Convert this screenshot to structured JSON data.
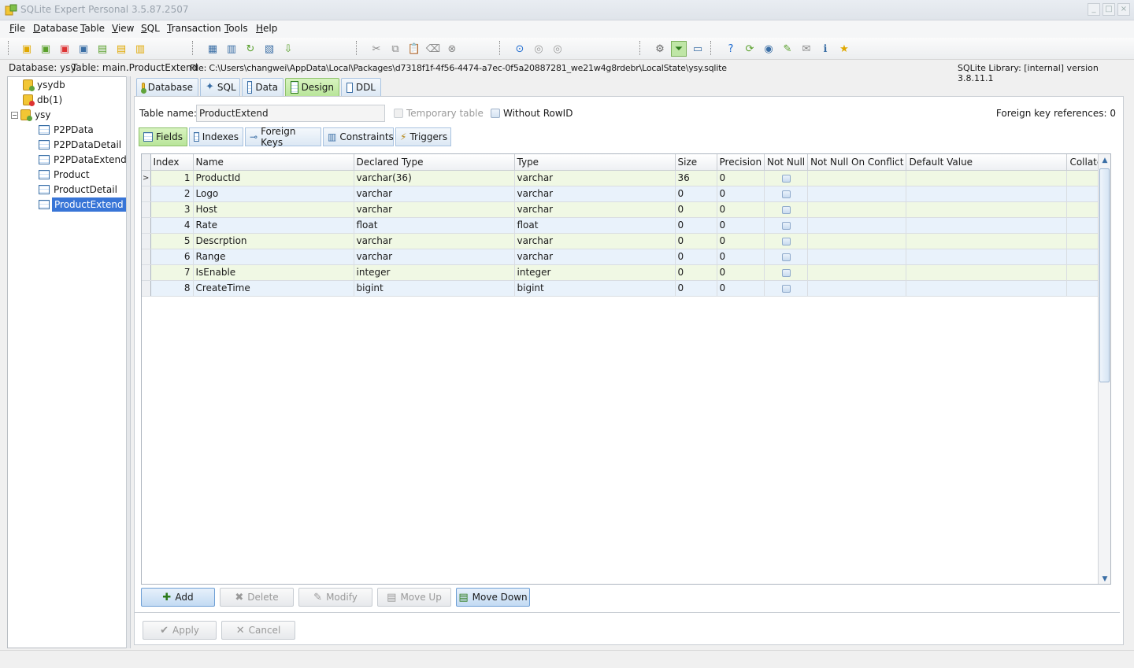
{
  "window": {
    "title": "SQLite Expert Personal 3.5.87.2507"
  },
  "menu": [
    "File",
    "Database",
    "Table",
    "View",
    "SQL",
    "Transaction",
    "Tools",
    "Help"
  ],
  "menu_access_keys": [
    "F",
    "D",
    "T",
    "V",
    "S",
    "T",
    "T",
    "H"
  ],
  "path_bar": {
    "database": "Database: ysy",
    "table": "Table: main.ProductExtend",
    "file": "File: C:\\Users\\changwei\\AppData\\Local\\Packages\\d7318f1f-4f56-4474-a7ec-0f5a20887281_we21w4g8rdebr\\LocalState\\ysy.sqlite",
    "library": "SQLite Library: [internal] version 3.8.11.1"
  },
  "tree": {
    "nodes": [
      {
        "label": "ysydb",
        "icon": "database-icon"
      },
      {
        "label": "db(1)",
        "icon": "database-error-icon"
      },
      {
        "label": "ysy",
        "icon": "database-icon"
      },
      {
        "label": "P2PData",
        "icon": "table-icon"
      },
      {
        "label": "P2PDataDetail",
        "icon": "table-icon"
      },
      {
        "label": "P2PDataExtend",
        "icon": "table-icon"
      },
      {
        "label": "Product",
        "icon": "table-icon"
      },
      {
        "label": "ProductDetail",
        "icon": "table-icon"
      },
      {
        "label": "ProductExtend",
        "icon": "table-icon",
        "selected": true
      }
    ]
  },
  "main_tabs": [
    {
      "label": "Database"
    },
    {
      "label": "SQL"
    },
    {
      "label": "Data"
    },
    {
      "label": "Design",
      "active": true
    },
    {
      "label": "DDL"
    }
  ],
  "design": {
    "table_name_label": "Table name:",
    "table_name_value": "ProductExtend",
    "temporary_label": "Temporary table",
    "without_rowid_label": "Without RowID",
    "fk_refs": "Foreign key references: 0"
  },
  "sub_tabs": [
    {
      "label": "Fields",
      "active": true
    },
    {
      "label": "Indexes"
    },
    {
      "label": "Foreign Keys"
    },
    {
      "label": "Constraints"
    },
    {
      "label": "Triggers"
    }
  ],
  "grid": {
    "columns": [
      "Index",
      "Name",
      "Declared Type",
      "Type",
      "Size",
      "Precision",
      "Not Null",
      "Not Null On Conflict",
      "Default Value",
      "Collate"
    ],
    "rows": [
      {
        "index": "1",
        "name": "ProductId",
        "declared": "varchar(36)",
        "type": "varchar",
        "size": "36",
        "precision": "0"
      },
      {
        "index": "2",
        "name": "Logo",
        "declared": "varchar",
        "type": "varchar",
        "size": "0",
        "precision": "0"
      },
      {
        "index": "3",
        "name": "Host",
        "declared": "varchar",
        "type": "varchar",
        "size": "0",
        "precision": "0"
      },
      {
        "index": "4",
        "name": "Rate",
        "declared": "float",
        "type": "float",
        "size": "0",
        "precision": "0"
      },
      {
        "index": "5",
        "name": "Descrption",
        "declared": "varchar",
        "type": "varchar",
        "size": "0",
        "precision": "0"
      },
      {
        "index": "6",
        "name": "Range",
        "declared": "varchar",
        "type": "varchar",
        "size": "0",
        "precision": "0"
      },
      {
        "index": "7",
        "name": "IsEnable",
        "declared": "integer",
        "type": "integer",
        "size": "0",
        "precision": "0"
      },
      {
        "index": "8",
        "name": "CreateTime",
        "declared": "bigint",
        "type": "bigint",
        "size": "0",
        "precision": "0"
      }
    ],
    "current_row_marker": ">"
  },
  "buttons": {
    "add": "Add",
    "delete": "Delete",
    "modify": "Modify",
    "move_up": "Move Up",
    "move_down": "Move Down",
    "apply": "Apply",
    "cancel": "Cancel"
  },
  "colors": {
    "accent": "#3875d7",
    "active_tab": "#b9e59a",
    "row_even": "#f0f8e4",
    "row_odd": "#e9f2fb"
  }
}
